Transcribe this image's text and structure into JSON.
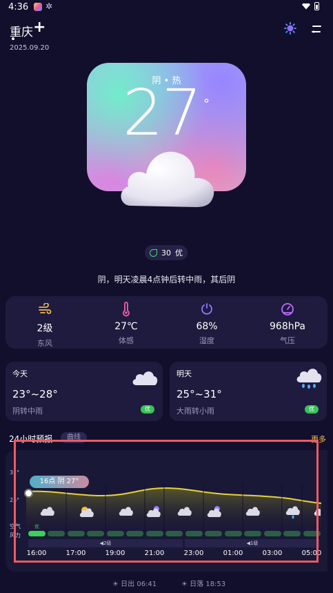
{
  "status": {
    "time": "4:36",
    "gear_icon": "gear-icon",
    "wifi_icon": "wifi-icon",
    "battery_icon": "battery-icon"
  },
  "header": {
    "city": "重庆",
    "add_icon": "+",
    "date": "2025.09.20",
    "sun_icon": "sun-icon",
    "menu_icon": "menu-icon"
  },
  "hero": {
    "condition": "阴 • 热",
    "temperature": "27",
    "degree": "°"
  },
  "aqi": {
    "value": "30",
    "level": "优"
  },
  "summary": "阴，明天凌晨4点钟后转中雨，其后阴",
  "stats": [
    {
      "value": "2级",
      "label": "东风",
      "icon": "wind-icon",
      "color": "#f0b84a"
    },
    {
      "value": "27℃",
      "label": "体感",
      "icon": "thermometer-icon",
      "color": "#f060a8"
    },
    {
      "value": "68%",
      "label": "湿度",
      "icon": "humidity-icon",
      "color": "#8a7cff"
    },
    {
      "value": "968hPa",
      "label": "气压",
      "icon": "pressure-icon",
      "color": "#c06cff"
    }
  ],
  "today": {
    "title": "今天",
    "range": "23°~28°",
    "desc": "阴转中雨",
    "aqi": "优"
  },
  "tomorrow": {
    "title": "明天",
    "range": "25°~31°",
    "desc": "大雨转小雨",
    "aqi": "优"
  },
  "forecast": {
    "title": "24小时预报",
    "tab": "曲线",
    "more": "更多",
    "current_badge": "16点 阴 27°",
    "y_high": "31°",
    "y_low": "25°",
    "row_label_air": "空气",
    "row_label_wind": "风力",
    "aqi_first": "优",
    "wind_segments": [
      "◀2级",
      "◀1级"
    ],
    "times": [
      "16:00",
      "17:00",
      "19:00",
      "21:00",
      "23:00",
      "01:00",
      "03:00",
      "05:00"
    ],
    "sunrise_label": "日出 06:41",
    "sunset_label": "日落 18:53"
  },
  "colors": {
    "accent_yellow": "#f0c040",
    "aqi_green": "#39c25a",
    "highlight_red": "#f05a62"
  }
}
